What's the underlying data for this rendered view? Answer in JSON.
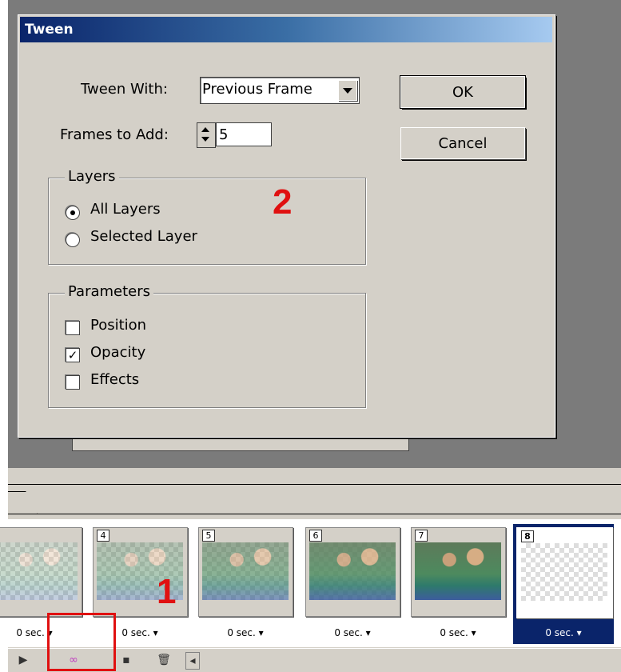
{
  "dialog": {
    "title": "Tween",
    "tween_with_label": "Tween With:",
    "tween_with_value": "Previous Frame",
    "frames_to_add_label": "Frames to Add:",
    "frames_to_add_value": "5",
    "ok_label": "OK",
    "cancel_label": "Cancel",
    "layers_group": {
      "legend": "Layers",
      "options": [
        {
          "label": "All Layers",
          "checked": true
        },
        {
          "label": "Selected Layer",
          "checked": false
        }
      ]
    },
    "parameters_group": {
      "legend": "Parameters",
      "options": [
        {
          "label": "Position",
          "checked": false
        },
        {
          "label": "Opacity",
          "checked": true
        },
        {
          "label": "Effects",
          "checked": false
        }
      ]
    },
    "annotation_marker": "2"
  },
  "animation_panel": {
    "frames": [
      {
        "number": "",
        "delay": "0 sec. ▾"
      },
      {
        "number": "4",
        "delay": "0 sec. ▾"
      },
      {
        "number": "5",
        "delay": "0 sec. ▾"
      },
      {
        "number": "6",
        "delay": "0 sec. ▾"
      },
      {
        "number": "7",
        "delay": "0 sec. ▾"
      },
      {
        "number": "8",
        "delay": "0 sec. ▾",
        "selected": true
      }
    ],
    "annotation_marker": "1"
  },
  "colors": {
    "accent_red": "#e01010",
    "selection_blue": "#0a246a",
    "dialog_face": "#d4d0c8"
  }
}
